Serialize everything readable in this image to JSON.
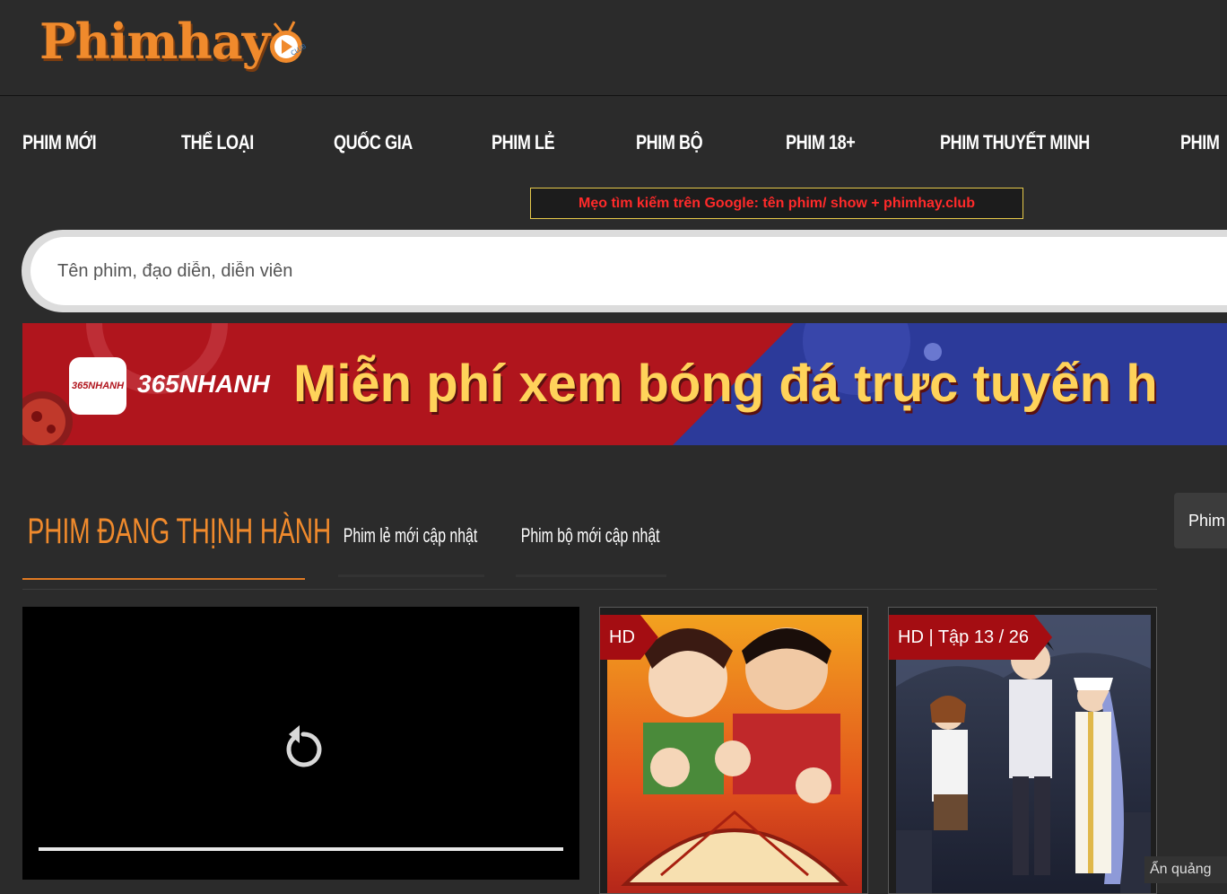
{
  "header": {
    "logo_text": "Phimhay",
    "logo_badge_text": "CLUB"
  },
  "nav": {
    "items": [
      {
        "label": "PHIM MỚI"
      },
      {
        "label": "THỂ LOẠI"
      },
      {
        "label": "QUỐC GIA"
      },
      {
        "label": "PHIM LẺ"
      },
      {
        "label": "PHIM BỘ"
      },
      {
        "label": "PHIM 18+"
      },
      {
        "label": "PHIM THUYẾT MINH"
      },
      {
        "label": "PHIM"
      }
    ]
  },
  "tip": {
    "text": "Mẹo tìm kiếm trên Google: tên phim/ show + phimhay.club"
  },
  "search": {
    "placeholder": "Tên phim, đạo diễn, diễn viên",
    "value": ""
  },
  "banner": {
    "icon_text": "365NHANH",
    "brand": "365NHANH",
    "headline": "Miễn phí xem bóng đá trực tuyến h"
  },
  "tabs": {
    "active": "PHIM ĐANG THỊNH HÀNH",
    "items": [
      {
        "label": "Phim lẻ mới cập nhật"
      },
      {
        "label": "Phim bộ mới cập nhật"
      }
    ]
  },
  "side_button": {
    "label": "Phim"
  },
  "movies": [
    {
      "badge": "HD"
    },
    {
      "badge": "HD | Tập 13 / 26"
    }
  ],
  "hide_ads": {
    "label": "Ẩn quảng"
  },
  "colors": {
    "background": "#2b2b2b",
    "accent": "#f08a2c",
    "tip_text": "#ff2a2a",
    "badge": "#a40d12"
  }
}
